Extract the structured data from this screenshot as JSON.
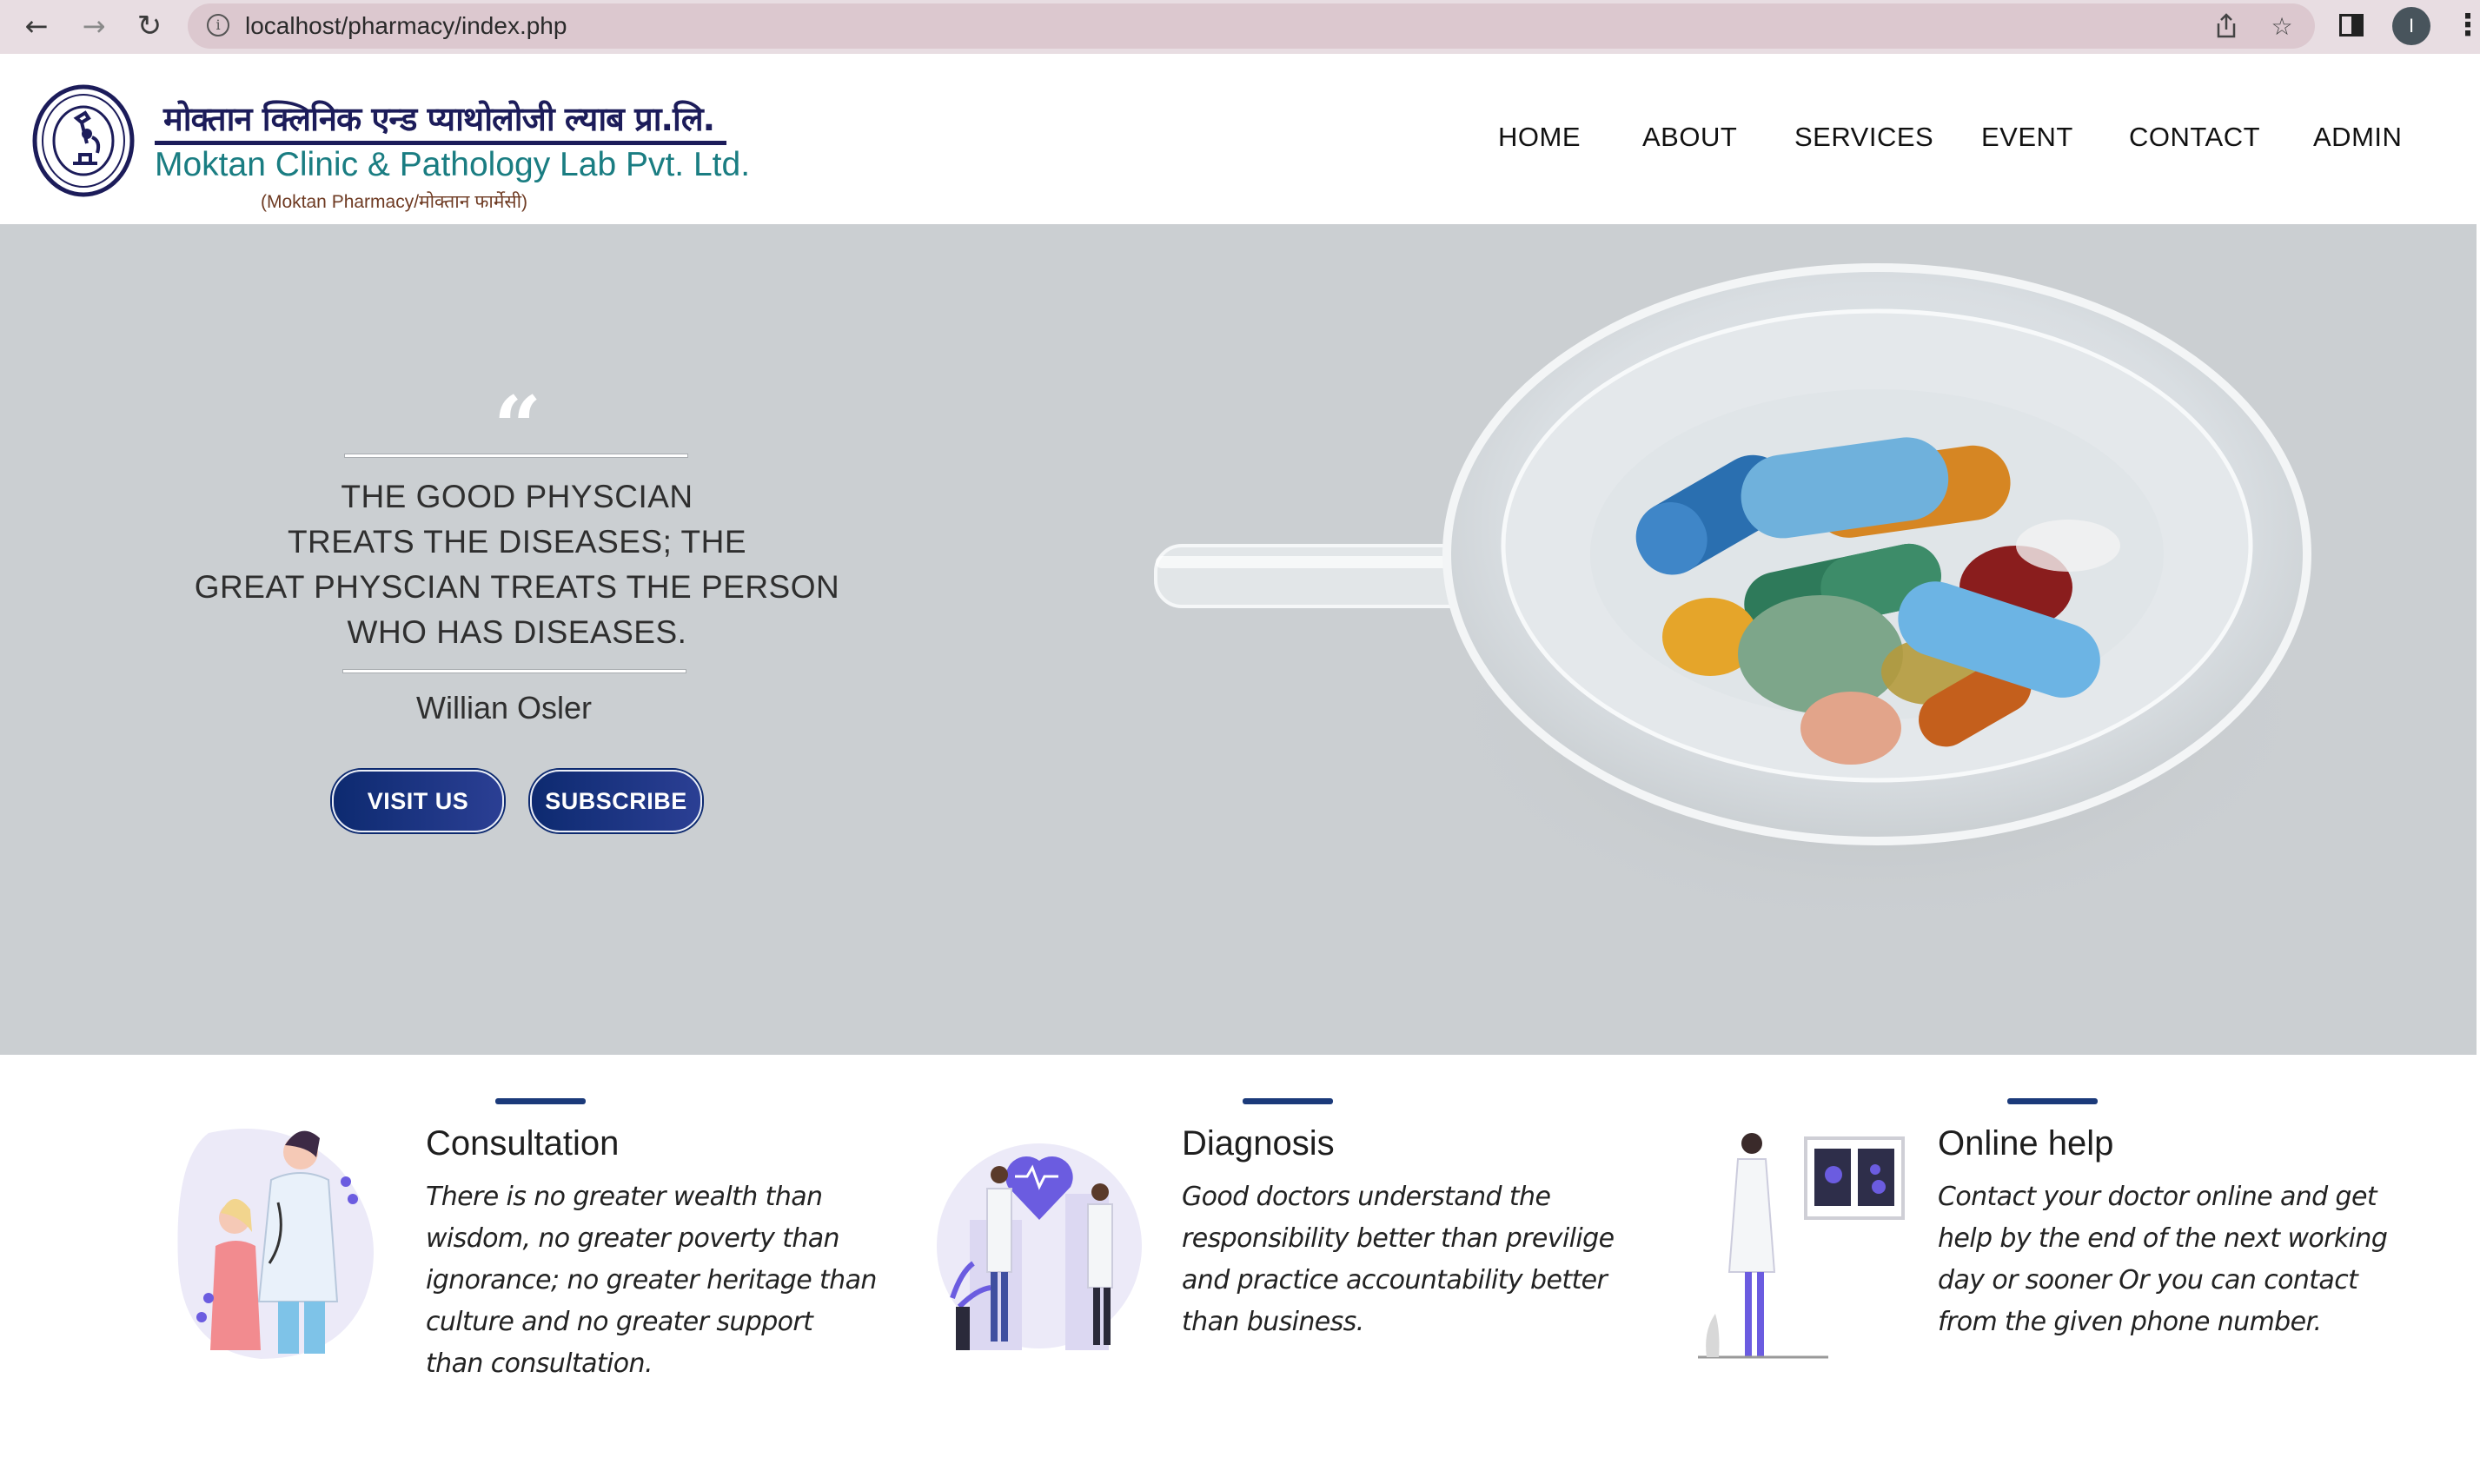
{
  "browser": {
    "url": "localhost/pharmacy/index.php",
    "profile_initial": "I",
    "icons": [
      "back-arrow-icon",
      "forward-arrow-icon",
      "reload-icon",
      "info-icon",
      "share-icon",
      "star-icon",
      "side-panel-icon",
      "more-menu-icon"
    ]
  },
  "brand": {
    "name_hindi": "मोक्तान क्लिनिक एन्ड प्याथोलोजी ल्याब प्रा.लि.",
    "name_english": "Moktan Clinic & Pathology Lab Pvt. Ltd.",
    "subtitle": "(Moktan Pharmacy/मोक्तान फार्मेसी)",
    "color_primary": "#1c1c5a",
    "color_teal": "#1a7d82"
  },
  "nav": {
    "items": [
      "HOME",
      "ABOUT",
      "SERVICES",
      "EVENT",
      "CONTACT",
      "ADMIN"
    ]
  },
  "hero": {
    "quote_lines": [
      "THE GOOD PHYSCIAN",
      "TREATS THE DISEASES; THE",
      "GREAT PHYSCIAN TREATS THE PERSON",
      "WHO HAS DISEASES."
    ],
    "author": "Willian Osler",
    "buttons": {
      "visit": "VISIT US",
      "subscribe": "SUBSCRIBE"
    },
    "background": "#cbcfd2",
    "button_color": "#0d2a70"
  },
  "features": [
    {
      "title": "Consultation",
      "text": "There is no greater wealth than wisdom, no greater poverty than ignorance; no greater heritage than culture and no greater support than consultation."
    },
    {
      "title": "Diagnosis",
      "text": "Good doctors understand the responsibility better than previlige and practice accountability better than business."
    },
    {
      "title": "Online help",
      "text": "Contact your doctor online and get help by the end of the next working day or sooner Or you can contact from the given phone number."
    }
  ]
}
